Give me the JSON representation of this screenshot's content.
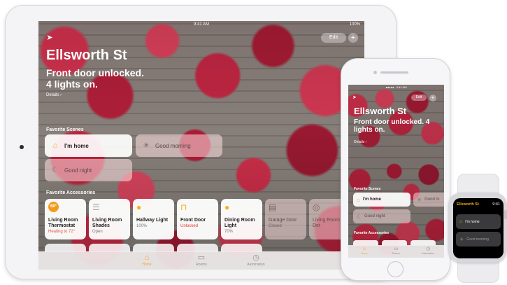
{
  "colors": {
    "accent": "#f5a623",
    "alert": "#e0583a"
  },
  "ipad": {
    "status": {
      "time": "9:41 AM",
      "battery": "100%"
    },
    "edit_label": "Edit",
    "add_label": "+",
    "title": "Ellsworth St",
    "status_text": "Front door unlocked. 4 lights on.",
    "details_label": "Details ›",
    "favorite_scenes_label": "Favorite Scenes",
    "scenes": [
      {
        "label": "I'm home",
        "icon": "house-person-icon"
      },
      {
        "label": "Good morning",
        "icon": "sunrise-icon"
      },
      {
        "label": "Good night",
        "icon": "moon-house-icon"
      }
    ],
    "favorite_accessories_label": "Favorite Accessories",
    "accessories": [
      {
        "name": "Living Room Thermostat",
        "state": "Heating to 72°",
        "badge": "68°",
        "icon": "thermostat-icon"
      },
      {
        "name": "Living Room Shades",
        "state": "Open",
        "icon": "shades-icon"
      },
      {
        "name": "Hallway Light",
        "state": "100%",
        "icon": "lightbulb-icon"
      },
      {
        "name": "Front Door",
        "state": "Unlocked",
        "icon": "lock-open-icon"
      },
      {
        "name": "Dining Room Light",
        "state": "70%",
        "icon": "lightbulb-icon"
      },
      {
        "name": "Garage Door",
        "state": "Closed",
        "icon": "garage-icon"
      },
      {
        "name": "Living Room Smoke Det",
        "state": "",
        "icon": "smoke-detector-icon"
      }
    ],
    "tabs": [
      {
        "label": "Home",
        "icon": "house-icon",
        "active": true
      },
      {
        "label": "Rooms",
        "icon": "rooms-icon",
        "active": false
      },
      {
        "label": "Automation",
        "icon": "clock-icon",
        "active": false
      }
    ]
  },
  "iphone": {
    "edit_label": "Edit",
    "add_label": "+",
    "title": "Ellsworth St",
    "status_text": "Front door unlocked. 4 lights on.",
    "details_label": "Details ›",
    "favorite_scenes_label": "Favorite Scenes",
    "scenes": [
      {
        "label": "I'm home"
      },
      {
        "label": "Good m"
      },
      {
        "label": "Good night"
      }
    ],
    "favorite_accessories_label": "Favorite Accessories",
    "tabs": [
      {
        "label": "Home",
        "active": true
      },
      {
        "label": "Rooms",
        "active": false
      },
      {
        "label": "Automation",
        "active": false
      }
    ]
  },
  "watch": {
    "title": "Ellsworth St",
    "time": "9:41",
    "scenes": [
      {
        "label": "I'm home"
      },
      {
        "label": "Good morning"
      }
    ]
  }
}
